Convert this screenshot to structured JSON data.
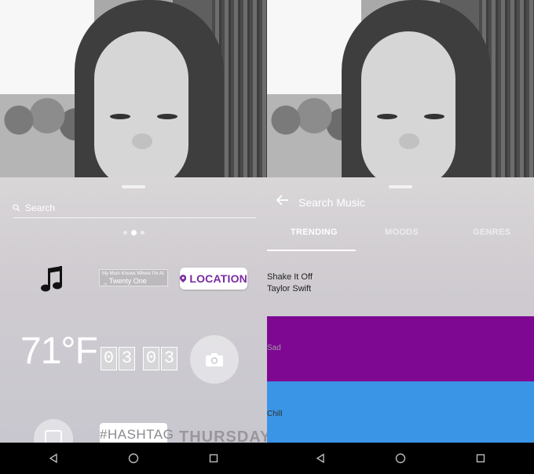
{
  "left_panel": {
    "search": {
      "label": "Search"
    },
    "stickers": {
      "song": {
        "line1": "My Mum Knows Where I'm At",
        "line2": "Twenty One Pilots"
      },
      "location": {
        "label": "LOCATION"
      },
      "temperature": {
        "label": "71°F"
      },
      "time": {
        "digits": [
          "0",
          "3",
          "0",
          "3"
        ]
      },
      "hashtag": {
        "label": "#HASHTAG"
      },
      "day": {
        "label": "THURSDAY"
      }
    },
    "page_dots": 3,
    "active_dot": 2
  },
  "right_panel": {
    "header": {
      "title": "Search Music"
    },
    "tabs": [
      {
        "label": "TRENDING",
        "active": true
      },
      {
        "label": "MOODS",
        "active": false
      },
      {
        "label": "GENRES",
        "active": false
      }
    ],
    "track": {
      "title": "Shake It Off",
      "artist": "Taylor Swift"
    },
    "moods": [
      {
        "label": "Sad",
        "color": "#7f0893"
      },
      {
        "label": "Chill",
        "color": "#3b95e6"
      }
    ]
  },
  "colors": {
    "location_accent": "#7b2aa0",
    "tray": "#d2cfd3",
    "navbar": "#000000"
  },
  "navbar": {
    "buttons": [
      "back-icon",
      "home-icon",
      "recents-icon"
    ]
  }
}
